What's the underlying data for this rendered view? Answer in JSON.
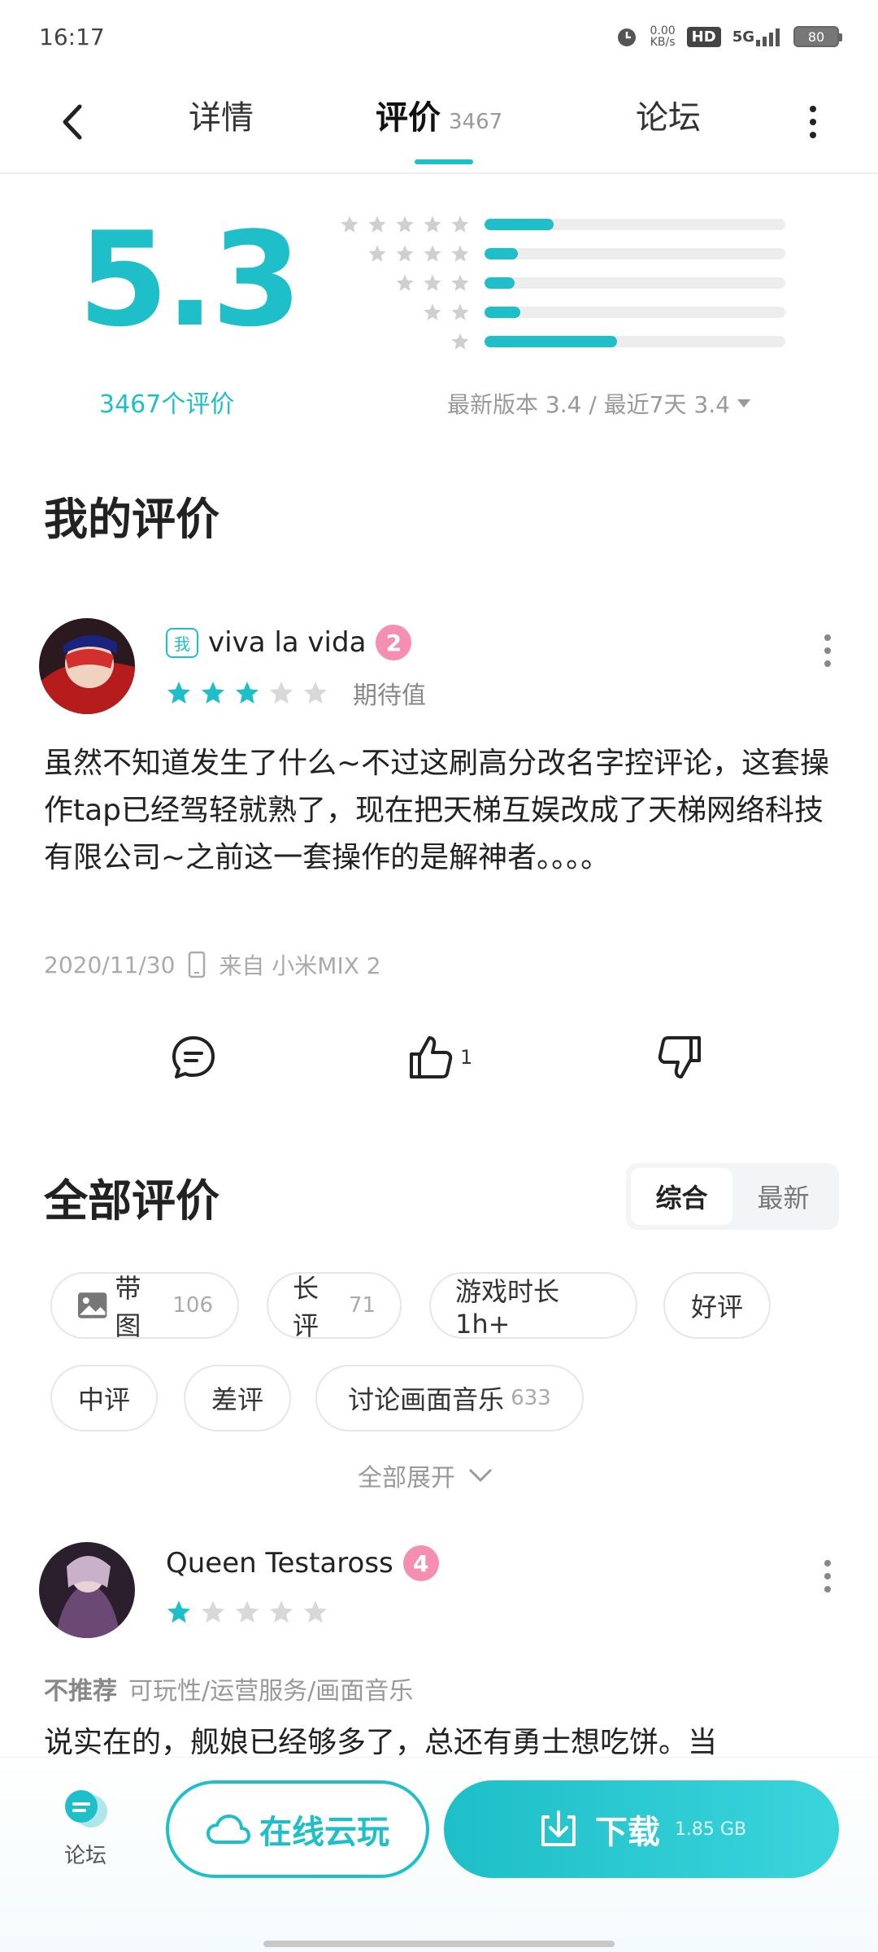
{
  "status_bar": {
    "time": "16:17",
    "net_speed": "0.00",
    "net_unit": "KB/s",
    "hd": "HD",
    "signal": "5G",
    "battery": "80"
  },
  "nav": {
    "tabs": [
      {
        "label": "详情"
      },
      {
        "label": "评价",
        "count": "3467"
      },
      {
        "label": "论坛"
      }
    ],
    "active_tab": "评价"
  },
  "rating": {
    "score": "5.3",
    "count_label": "3467个评价",
    "distribution": [
      {
        "stars": 5,
        "fraction": 0.23
      },
      {
        "stars": 4,
        "fraction": 0.11
      },
      {
        "stars": 3,
        "fraction": 0.1
      },
      {
        "stars": 2,
        "fraction": 0.12
      },
      {
        "stars": 1,
        "fraction": 0.44
      }
    ],
    "version_label": "最新版本 3.4 / 最近7天 3.4"
  },
  "my_review": {
    "section_title": "我的评价",
    "me_tag": "我",
    "username": "viva la vida",
    "level": "2",
    "stars": 3,
    "stars_total": 5,
    "rating_note": "期待值",
    "body": "虽然不知道发生了什么~不过这刷高分改名字控评论，这套操作tap已经驾轻就熟了，现在把天梯互娱改成了天梯网络科技有限公司~之前这一套操作的是解神者。。。。",
    "date": "2020/11/30",
    "device": "来自 小米MIX 2",
    "like_count": "1"
  },
  "all_reviews": {
    "section_title": "全部评价",
    "sort_options": [
      "综合",
      "最新"
    ],
    "active_sort": "综合",
    "chips": [
      {
        "label": "带图",
        "count": "106",
        "icon": "image-icon"
      },
      {
        "label": "长评",
        "count": "71"
      },
      {
        "label": "游戏时长 1h+",
        "count": ""
      },
      {
        "label": "好评",
        "count": ""
      },
      {
        "label": "中评",
        "count": ""
      },
      {
        "label": "差评",
        "count": ""
      },
      {
        "label": "讨论画面音乐",
        "count": "633"
      }
    ],
    "expand_label": "全部展开"
  },
  "review_2": {
    "username": "Queen Testaross",
    "level": "4",
    "stars": 1,
    "stars_total": 5,
    "tag_main": "不推荐",
    "tag_items": "可玩性/运营服务/画面音乐",
    "body": "说实在的，舰娘已经够多了，总还有勇士想吃饼。当"
  },
  "bottom": {
    "forum_label": "论坛",
    "cloud_label": "在线云玩",
    "download_label": "下载",
    "download_size": "1.85 GB"
  },
  "colors": {
    "accent": "#1ebfc8",
    "star_empty": "#d8d8d8",
    "badge_pink": "#f48fb1"
  }
}
